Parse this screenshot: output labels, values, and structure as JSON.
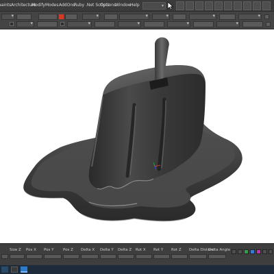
{
  "menu": {
    "items": [
      "aaints",
      "Architecture",
      "Modify",
      "Modes",
      "AddOns",
      "Ruby .Net Scripts",
      "Options",
      "Window",
      "Help"
    ]
  },
  "colors": {
    "ui_dark": "#3b3b3b",
    "toolbar": "#444444",
    "viewport_bg": "#ffffff",
    "model_gray": "#3d3d3d",
    "highlight_red": "#c83c2c",
    "taskbar": "#1d2b3a"
  },
  "icons": {
    "cursor": "cursor-arrow-icon",
    "taskbar": [
      "start-icon",
      "app-icon",
      "monitor-icon"
    ],
    "status": [
      "green-status-icon",
      "blue-status-icon",
      "magenta-status-icon"
    ]
  },
  "status_columns": [
    "Size Z",
    "Pos X",
    "Pos Y",
    "Pos Z",
    "Delta X",
    "Delta Y",
    "Delta Z",
    "Rot X",
    "Rot Y",
    "Rot Z",
    "Delta Distanc",
    "Delta Angle"
  ]
}
